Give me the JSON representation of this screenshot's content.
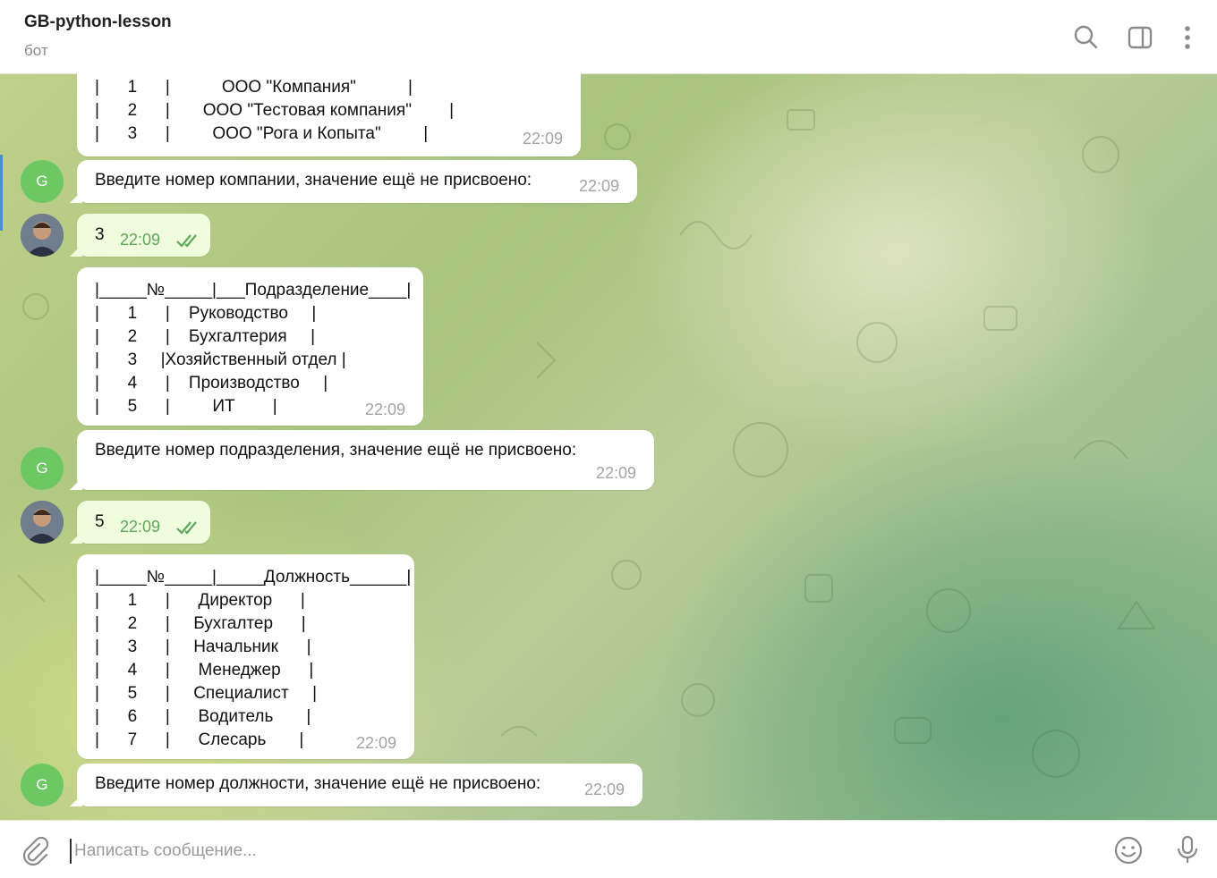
{
  "header": {
    "title": "GB-python-lesson",
    "status": "бот",
    "search_icon": "search-icon",
    "sidebar_icon": "sidebar-toggle-icon",
    "menu_icon": "more-vertical-icon"
  },
  "messages": {
    "companies": {
      "rows": [
        {
          "num": "1",
          "name": "ООО \"Компания\""
        },
        {
          "num": "2",
          "name": "ООО \"Тестовая компания\""
        },
        {
          "num": "3",
          "name": "ООО \"Рога и Копыта\""
        }
      ],
      "time": "22:09"
    },
    "prompt_company": {
      "text": "Введите номер компании, значение ещё не присвоено:",
      "time": "22:09"
    },
    "reply_company": {
      "text": "3",
      "time": "22:09"
    },
    "departments": {
      "header_num": "№",
      "header_name": "Подразделение",
      "rows": [
        {
          "num": "1",
          "name": "Руководство"
        },
        {
          "num": "2",
          "name": "Бухгалтерия"
        },
        {
          "num": "3",
          "name": "Хозяйственный отдел"
        },
        {
          "num": "4",
          "name": "Производство"
        },
        {
          "num": "5",
          "name": "ИТ"
        }
      ],
      "time": "22:09"
    },
    "prompt_department": {
      "text": "Введите номер подразделения, значение ещё не присвоено:",
      "time": "22:09"
    },
    "reply_department": {
      "text": "5",
      "time": "22:09"
    },
    "positions": {
      "header_num": "№",
      "header_name": "Должность",
      "rows": [
        {
          "num": "1",
          "name": "Директор"
        },
        {
          "num": "2",
          "name": "Бухгалтер"
        },
        {
          "num": "3",
          "name": "Начальник"
        },
        {
          "num": "4",
          "name": "Менеджер"
        },
        {
          "num": "5",
          "name": "Специалист"
        },
        {
          "num": "6",
          "name": "Водитель"
        },
        {
          "num": "7",
          "name": "Слесарь"
        }
      ],
      "time": "22:09"
    },
    "prompt_position": {
      "text": "Введите номер должности, значение ещё не присвоено:",
      "time": "22:09"
    }
  },
  "bot_avatar_letter": "G",
  "composer": {
    "placeholder": "Написать сообщение...",
    "attach_icon": "paperclip-icon",
    "emoji_icon": "emoji-icon",
    "mic_icon": "microphone-icon"
  },
  "colors": {
    "bot_avatar": "#6dc864",
    "outgoing_bubble": "#effdde",
    "read_check": "#5fa85a",
    "accent": "#4a90c8"
  }
}
